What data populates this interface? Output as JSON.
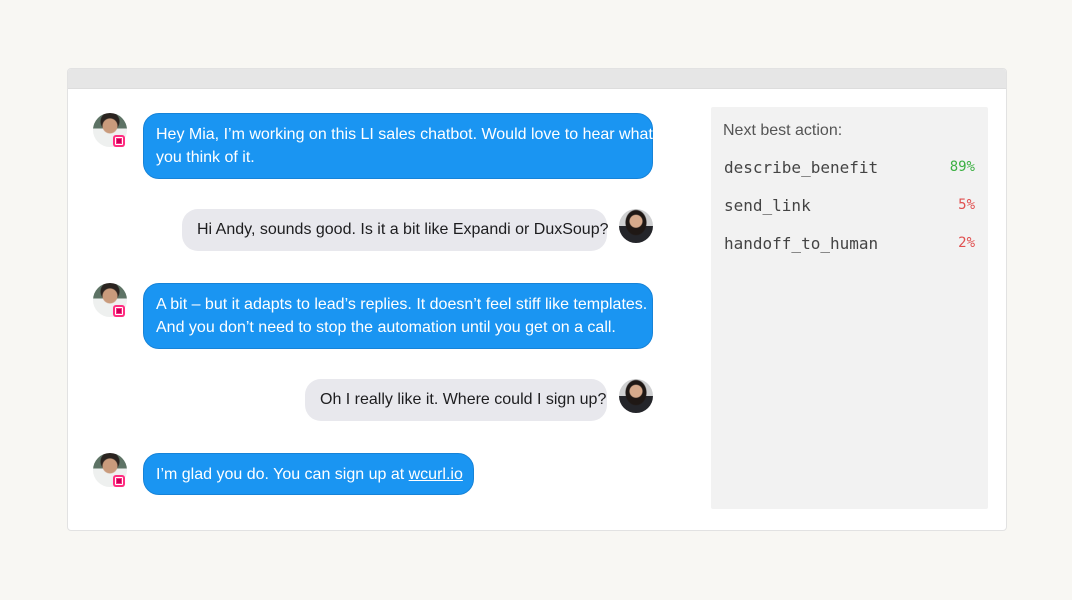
{
  "colors": {
    "bot_bubble": "#1a95f2",
    "user_bubble": "#e8e8ed",
    "badge": "#ff2d80",
    "pct_high": "#3cb043",
    "pct_low": "#e05050"
  },
  "chat": {
    "messages": [
      {
        "sender": "Andy",
        "text": "Hey Mia, I’m working on this LI sales chatbot. Would love to hear what",
        "text2": "you think of it."
      },
      {
        "sender": "Mia",
        "text": "Hi Andy, sounds good. Is it a bit like Expandi or DuxSoup?"
      },
      {
        "sender": "Andy",
        "text": "A bit – but it adapts to lead’s replies. It doesn’t feel stiff like templates.",
        "text2": "And you don’t need to stop the automation until you get on a call."
      },
      {
        "sender": "Mia",
        "text": "Oh I really like it. Where could I sign up?"
      },
      {
        "sender": "Andy",
        "text": "I’m glad you do. You can sign up at ",
        "link": "wcurl.io"
      }
    ]
  },
  "panel": {
    "title": "Next best action:",
    "actions": [
      {
        "name": "describe_benefit",
        "pct": "89%"
      },
      {
        "name": "send_link",
        "pct": "5%"
      },
      {
        "name": "handoff_to_human",
        "pct": "2%"
      }
    ]
  }
}
